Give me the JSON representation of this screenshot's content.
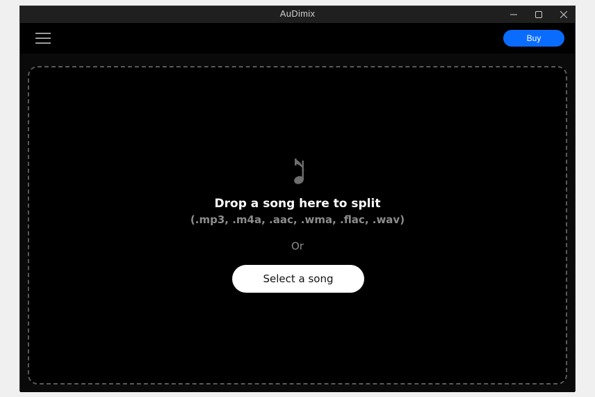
{
  "window": {
    "title": "AuDimix",
    "controls": [
      "minimize-icon",
      "maximize-icon",
      "close-icon"
    ]
  },
  "toolbar": {
    "menu_icon": "hamburger-menu-icon",
    "buy_label": "Buy"
  },
  "dropzone": {
    "icon": "music-note-icon",
    "title": "Drop a song here to split",
    "formats": "(.mp3, .m4a, .aac, .wma, .flac, .wav)",
    "or_text": "Or",
    "select_label": "Select a song"
  },
  "colors": {
    "accent": "#0a6cff",
    "background": "#000000",
    "titlebar": "#1f1f1f"
  }
}
